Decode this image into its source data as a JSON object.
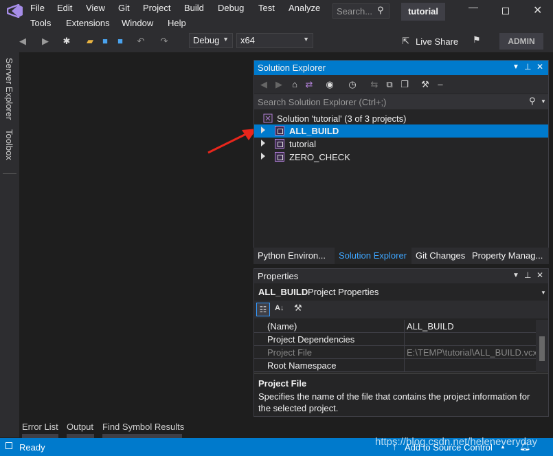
{
  "menu": {
    "row1": [
      "File",
      "Edit",
      "View",
      "Git",
      "Project",
      "Build",
      "Debug",
      "Test",
      "Analyze"
    ],
    "row2": [
      "Tools",
      "Extensions",
      "Window",
      "Help"
    ],
    "search_placeholder": "Search...",
    "solution_name": "tutorial",
    "live_share": "Live Share",
    "admin": "ADMIN"
  },
  "toolbar": {
    "config": "Debug",
    "platform": "x64"
  },
  "side_tabs": [
    "Server Explorer",
    "Toolbox"
  ],
  "solution_explorer": {
    "title": "Solution Explorer",
    "search_placeholder": "Search Solution Explorer (Ctrl+;)",
    "solution_label": "Solution 'tutorial' (3 of 3 projects)",
    "projects": [
      "ALL_BUILD",
      "tutorial",
      "ZERO_CHECK"
    ],
    "selected": "ALL_BUILD"
  },
  "bottom_tabs": [
    "Python Environ...",
    "Solution Explorer",
    "Git Changes",
    "Property Manag..."
  ],
  "properties": {
    "title": "Properties",
    "object_name": "ALL_BUILD",
    "object_type": "Project Properties",
    "rows": [
      {
        "name": "(Name)",
        "value": "ALL_BUILD"
      },
      {
        "name": "Project Dependencies",
        "value": ""
      },
      {
        "name": "Project File",
        "value": "E:\\TEMP\\tutorial\\ALL_BUILD.vcxp"
      },
      {
        "name": "Root Namespace",
        "value": ""
      }
    ],
    "desc_title": "Project File",
    "desc_text": "Specifies the name of the file that contains the project information for the selected project."
  },
  "tool_tabs": [
    "Error List",
    "Output",
    "Find Symbol Results"
  ],
  "status": {
    "ready": "Ready",
    "source_control": "Add to Source Control",
    "watermark": "https://blog.csdn.net/heleneveryday"
  },
  "colors": {
    "accent": "#007acc",
    "arrow": "#e8261c",
    "vs_logo": "#a68de8"
  }
}
